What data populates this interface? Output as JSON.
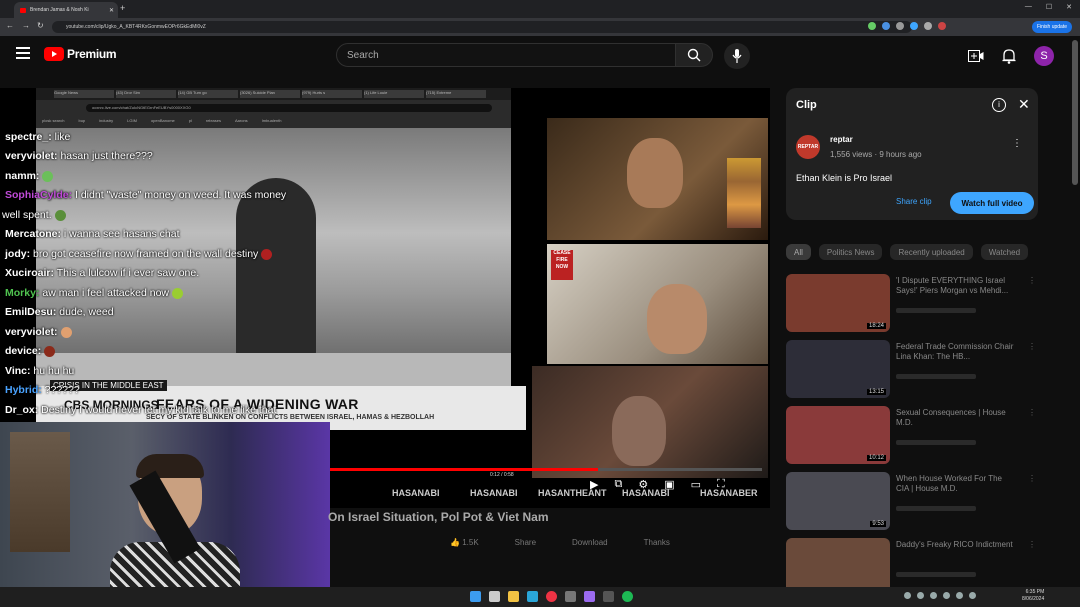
{
  "browser": {
    "tab_title": "Brendan Jamas & Nosh Ki",
    "url": "youtube.com/clip/Ugko_A_KBT4RKxGonmwEOPr6GkEdMl0vZ",
    "finish_update": "Finish update"
  },
  "inner_browser": {
    "tabs": [
      "Google News",
      "(43) Dror Sim",
      "(14) GB Turn go",
      "(3026) Suicide Plan",
      "(979) Hurts s",
      "(1) Life Louie",
      "(715) Extreme"
    ],
    "url": "ocxnrc.live.com/chat/ZuIcNGtEGrnFeEUBYs0000XXG0",
    "bookmarks": [
      "plosk search",
      "bup",
      "industry",
      "LGIM",
      "openBanome",
      "pl",
      "releases",
      "Aarons",
      "Imbualenth"
    ]
  },
  "youtube": {
    "brand": "Premium",
    "search_placeholder": "Search",
    "avatar_letter": "S"
  },
  "chat": [
    {
      "user": "spectre_:",
      "text": " like",
      "color": "#ffffff",
      "emote": ""
    },
    {
      "user": "veryviolet:",
      "text": " hasan just there???",
      "color": "#ffffff",
      "emote": ""
    },
    {
      "user": "namm:",
      "text": "",
      "color": "#ffffff",
      "emote": "#6bbf5a"
    },
    {
      "user": "SophiaCylde:",
      "text": " I didnt \"waste\" money on weed. It was money",
      "color": "#c04bd8",
      "emote": ""
    },
    {
      "user": "",
      "text": "well spent.",
      "color": "#ffffff",
      "emote": "#5a8f3a"
    },
    {
      "user": "Mercatone:",
      "text": " i wanna see hasans chat",
      "color": "#ffffff",
      "emote": ""
    },
    {
      "user": "jody:",
      "text": " bro got ceasefire now framed on the wall destiny",
      "color": "#ffffff",
      "emote": "#b02020"
    },
    {
      "user": "Xuciroair:",
      "text": " This a lulcow if i ever saw one.",
      "color": "#ffffff",
      "emote": ""
    },
    {
      "user": "Morky:",
      "text": " aw man i feel attacked now",
      "color": "#4fc24f",
      "emote": "#9acd32"
    },
    {
      "user": "EmilDesu:",
      "text": " dude, weed",
      "color": "#ffffff",
      "emote": ""
    },
    {
      "user": "veryviolet:",
      "text": "",
      "color": "#ffffff",
      "emote": "#e0a070"
    },
    {
      "user": "device:",
      "text": "",
      "color": "#ffffff",
      "emote": "#8b2a1a"
    },
    {
      "user": "Vinc:",
      "text": " hu hu hu",
      "color": "#ffffff",
      "emote": ""
    },
    {
      "user": "Hybrid:",
      "text": " ??????",
      "color": "#4aa3ff",
      "emote": ""
    },
    {
      "user": "Dr_ox:",
      "text": " Destiny I would never let my kid talk to me like that",
      "color": "#ffffff",
      "emote": ""
    }
  ],
  "broadcast": {
    "kicker": "CRISIS IN THE MIDDLE EAST",
    "network": "CBS MORNINGS",
    "headline": "FEARS OF A WIDENING WAR",
    "subline": "SECY OF STATE BLINKEN ON CONFLICTS BETWEEN ISRAEL, HAMAS & HEZBOLLAH",
    "sign": "CEASE FIRE NOW"
  },
  "stream_tags": [
    "HASANABI",
    "HASANABI",
    "HASANTHEANT",
    "HASANABI",
    "HASANABER"
  ],
  "player": {
    "progress": 0.62,
    "time": "0:12 / 0:58"
  },
  "video": {
    "title": "On Israel Situation, Pol Pot & Viet Nam",
    "likes": "1.5K",
    "share": "Share",
    "download": "Download",
    "thanks": "Thanks"
  },
  "clip_panel": {
    "title": "Clip",
    "channel": "reptar",
    "channel_avatar": "REPTAR",
    "meta": "1,556 views · 9 hours ago",
    "description": "Ethan Klein is Pro Israel",
    "share": "Share clip",
    "watch": "Watch full video"
  },
  "chips": [
    "All",
    "Politics News",
    "Recently uploaded",
    "Watched"
  ],
  "recommendations": [
    {
      "title": "'I Dispute EVERYTHING Israel Says!' Piers Morgan vs Mehdi...",
      "duration": "18:24",
      "color": "#7a3b2e"
    },
    {
      "title": "Federal Trade Commission Chair Lina Khan: The HB...",
      "duration": "13:15",
      "color": "#2d2d38"
    },
    {
      "title": "Sexual Consequences | House M.D.",
      "duration": "10:12",
      "color": "#8a3a3a"
    },
    {
      "title": "When House Worked For The CIA | House M.D.",
      "duration": "9:53",
      "color": "#4a4a52"
    },
    {
      "title": "Daddy's Freaky RICO Indictment",
      "duration": "",
      "color": "#6a4a3a"
    }
  ],
  "taskbar": {
    "time": "6:35 PM",
    "date": "8/06/2024"
  }
}
